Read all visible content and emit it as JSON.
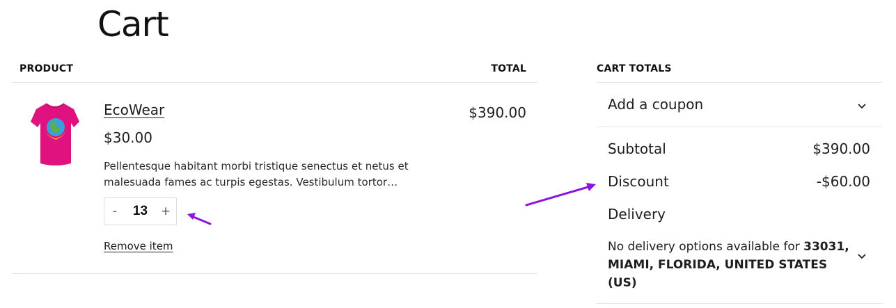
{
  "page": {
    "title": "Cart"
  },
  "cart": {
    "headers": {
      "product": "PRODUCT",
      "total": "TOTAL"
    },
    "item": {
      "image_icon": "tshirt-globe-image",
      "name": "EcoWear",
      "price": "$30.00",
      "description": "Pellentesque habitant morbi tristique senectus et netus et malesuada fames ac turpis egestas. Vestibulum tortor…",
      "quantity": "13",
      "decrement_label": "-",
      "increment_label": "+",
      "remove_label": "Remove item",
      "line_total": "$390.00"
    }
  },
  "totals": {
    "heading": "CART TOTALS",
    "coupon_label": "Add a coupon",
    "subtotal_label": "Subtotal",
    "subtotal_value": "$390.00",
    "discount_label": "Discount",
    "discount_value": "-$60.00",
    "delivery_label": "Delivery",
    "delivery_note_prefix": "No delivery options available for",
    "delivery_note_location": "33031, MIAMI, FLORIDA, UNITED STATES (US)"
  },
  "colors": {
    "arrow": "#8a16e0",
    "tshirt": "#e0127f"
  }
}
